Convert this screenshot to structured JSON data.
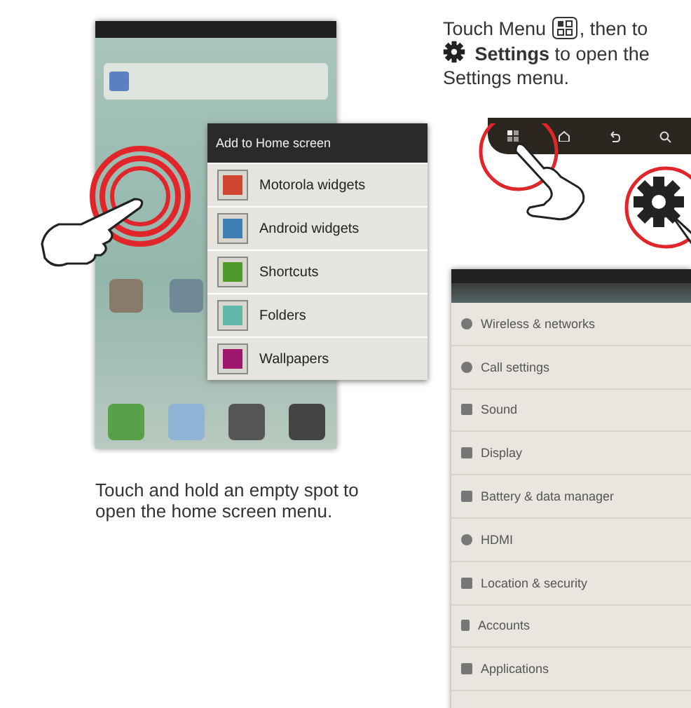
{
  "home_menu": {
    "title": "Add to Home screen",
    "items": [
      {
        "label": "Motorola widgets"
      },
      {
        "label": "Android widgets"
      },
      {
        "label": "Shortcuts"
      },
      {
        "label": "Folders"
      },
      {
        "label": "Wallpapers"
      }
    ]
  },
  "caption": "Touch and hold an empty spot to open the home screen menu.",
  "instruction": {
    "part_1": "Touch Menu",
    "part_2": ", then to",
    "part_3": "**Settings** to open the",
    "part_4": "Settings menu."
  },
  "settings_screen": {
    "items": [
      {
        "label": "Wireless & networks"
      },
      {
        "label": "Call settings"
      },
      {
        "label": "Sound"
      },
      {
        "label": "Display"
      },
      {
        "label": "Battery & data manager"
      },
      {
        "label": "HDMI"
      },
      {
        "label": "Location & security"
      },
      {
        "label": "Accounts"
      },
      {
        "label": "Applications"
      }
    ]
  }
}
